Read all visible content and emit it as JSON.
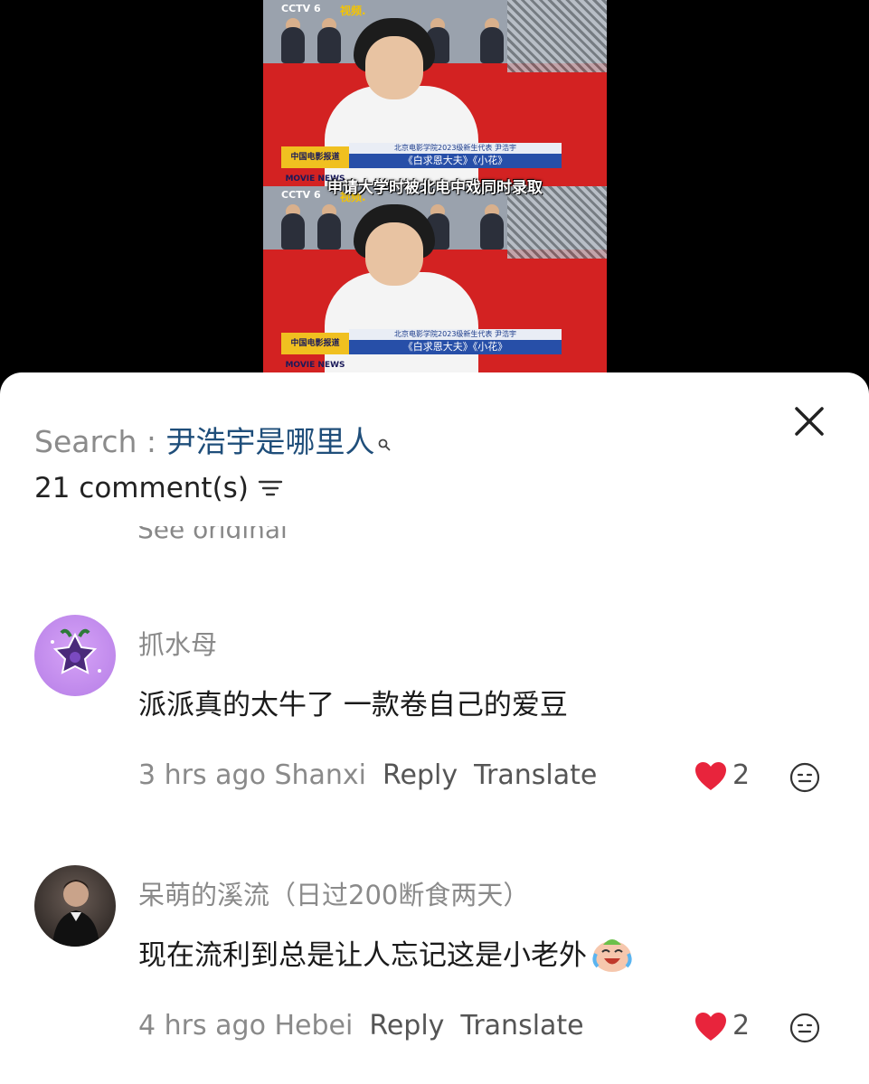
{
  "video": {
    "channel_logo": "CCTV 6",
    "channel_sub": "电影",
    "logo2": "视频.",
    "caption_top": "北京电影学院2023级新生代表 尹浩宇",
    "caption_bottom": "《白求恩大夫》《小花》",
    "movie_badge": "中国电影报道 MOVIE NEWS",
    "subtitle": "申请大学时被北电中戏同时录取"
  },
  "search": {
    "label": "Search : ",
    "query": "尹浩宇是哪里人"
  },
  "comments_header": {
    "count_label": "21 comment(s)"
  },
  "cut_text": "See original",
  "comments": [
    {
      "username": "抓水母",
      "text": "派派真的太牛了 一款卷自己的爱豆",
      "time": "3 hrs ago",
      "location": "Shanxi",
      "reply_label": "Reply",
      "translate_label": "Translate",
      "likes": "2"
    },
    {
      "username": "呆萌的溪流（日过200断食两天）",
      "text": "现在流利到总是让人忘记这是小老外",
      "time": "4 hrs ago",
      "location": "Hebei",
      "reply_label": "Reply",
      "translate_label": "Translate",
      "likes": "2"
    }
  ],
  "colors": {
    "heart": "#e8243c",
    "query": "#1f4e7a",
    "avatar1": "#c58af0"
  }
}
